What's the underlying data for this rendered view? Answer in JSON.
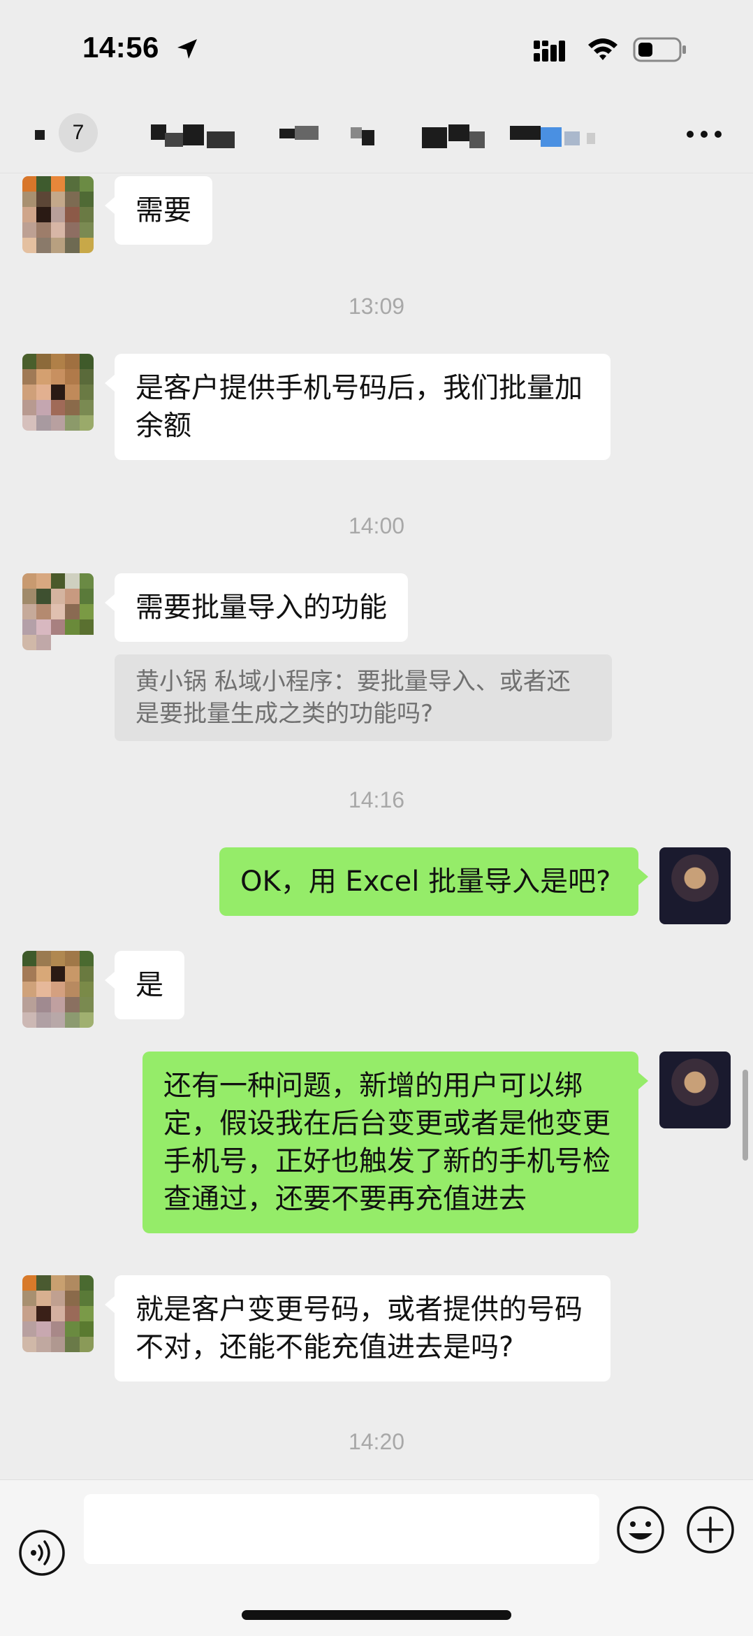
{
  "status_bar": {
    "time": "14:56"
  },
  "header": {
    "badge_count": "7",
    "more_icon": "ellipsis-icon"
  },
  "messages": [
    {
      "side": "in",
      "text": "需要"
    },
    {
      "timestamp": "13:09"
    },
    {
      "side": "in",
      "text": "是客户提供手机号码后，我们批量加余额"
    },
    {
      "timestamp": "14:00"
    },
    {
      "side": "in",
      "text": "需要批量导入的功能",
      "quote": "黄小锅 私域小程序：要批量导入、或者还是要批量生成之类的功能吗?"
    },
    {
      "timestamp": "14:16"
    },
    {
      "side": "out",
      "text": "OK，用 Excel 批量导入是吧?"
    },
    {
      "side": "in",
      "text": "是"
    },
    {
      "side": "out",
      "text": "还有一种问题，新增的用户可以绑定，假设我在后台变更或者是他变更手机号，正好也触发了新的手机号检查通过，还要不要再充值进去"
    },
    {
      "side": "in",
      "text": "就是客户变更号码，或者提供的号码不对，还能不能充值进去是吗?"
    },
    {
      "timestamp": "14:20"
    }
  ],
  "input_bar": {
    "value": "",
    "voice_icon": "voice-icon",
    "emoji_icon": "emoji-icon",
    "plus_icon": "plus-icon"
  },
  "colors": {
    "background": "#ededed",
    "bubble_in": "#ffffff",
    "bubble_out": "#95ec69",
    "quote_bg": "#e1e1e1"
  }
}
